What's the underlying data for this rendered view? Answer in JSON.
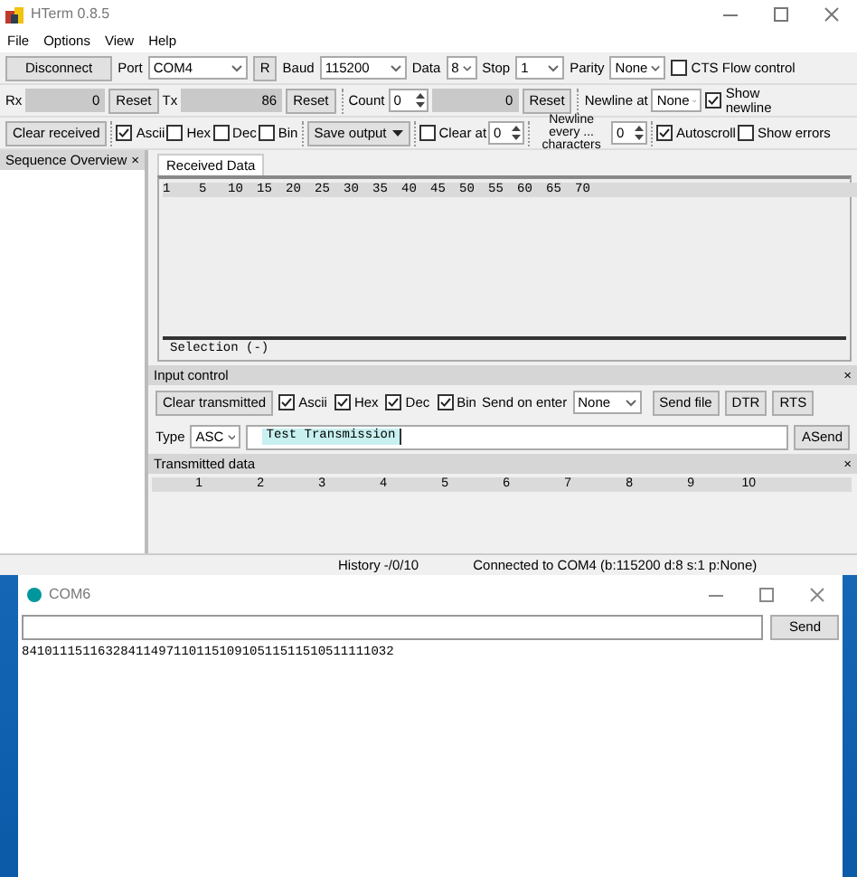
{
  "hterm": {
    "title": "HTerm 0.8.5",
    "menu": [
      "File",
      "Options",
      "View",
      "Help"
    ],
    "connection": {
      "button": "Disconnect",
      "port_label": "Port",
      "port": "COM4",
      "refresh": "R",
      "baud_label": "Baud",
      "baud": "115200",
      "data_label": "Data",
      "data": "8",
      "stop_label": "Stop",
      "stop": "1",
      "parity_label": "Parity",
      "parity": "None",
      "cts": {
        "label": "CTS Flow control",
        "checked": false
      }
    },
    "counters": {
      "rx_label": "Rx",
      "rx": "0",
      "rx_reset": "Reset",
      "tx_label": "Tx",
      "tx": "86",
      "tx_reset": "Reset",
      "count_label": "Count",
      "count": "0",
      "count_value": "0",
      "count_reset": "Reset",
      "newline_label": "Newline at",
      "newline": "None",
      "show_newline": {
        "label": "Show newline",
        "checked": true
      }
    },
    "receive_toolbar": {
      "clear": "Clear received",
      "formats": [
        {
          "label": "Ascii",
          "checked": true
        },
        {
          "label": "Hex",
          "checked": false
        },
        {
          "label": "Dec",
          "checked": false
        },
        {
          "label": "Bin",
          "checked": false
        }
      ],
      "save": "Save output",
      "clear_at": {
        "label": "Clear at",
        "checked": false,
        "value": "0"
      },
      "newline_every_label": "Newline every ... characters",
      "newline_every": "0",
      "options": [
        {
          "label": "Autoscroll",
          "checked": true
        },
        {
          "label": "Show errors",
          "checked": false
        }
      ]
    },
    "sequence_panel": {
      "title": "Sequence Overview",
      "close": "×"
    },
    "received": {
      "tab": "Received Data",
      "ruler": [
        "1",
        "5",
        "10",
        "15",
        "20",
        "25",
        "30",
        "35",
        "40",
        "45",
        "50",
        "55",
        "60",
        "65",
        "70"
      ],
      "selection": "Selection (-)"
    },
    "input_control": {
      "title": "Input control",
      "close": "×",
      "clear": "Clear transmitted",
      "formats": [
        {
          "label": "Ascii",
          "checked": true
        },
        {
          "label": "Hex",
          "checked": true
        },
        {
          "label": "Dec",
          "checked": true
        },
        {
          "label": "Bin",
          "checked": true
        }
      ],
      "send_on_enter_label": "Send on enter",
      "send_on_enter": "None",
      "buttons": [
        "Send file",
        "DTR",
        "RTS"
      ],
      "type_label": "Type",
      "type": "ASC",
      "input": "Test Transmission",
      "send": "ASend"
    },
    "transmitted": {
      "title": "Transmitted data",
      "close": "×",
      "ruler": [
        "1",
        "2",
        "3",
        "4",
        "5",
        "6",
        "7",
        "8",
        "9",
        "10"
      ]
    },
    "status_bar": [
      "History -/0/10",
      "Connected to COM4 (b:115200 d:8 s:1 p:None)"
    ]
  },
  "serial_monitor": {
    "title": "COM6",
    "send": "Send",
    "output": "8410111511632841149711011510910511511510511111032"
  }
}
